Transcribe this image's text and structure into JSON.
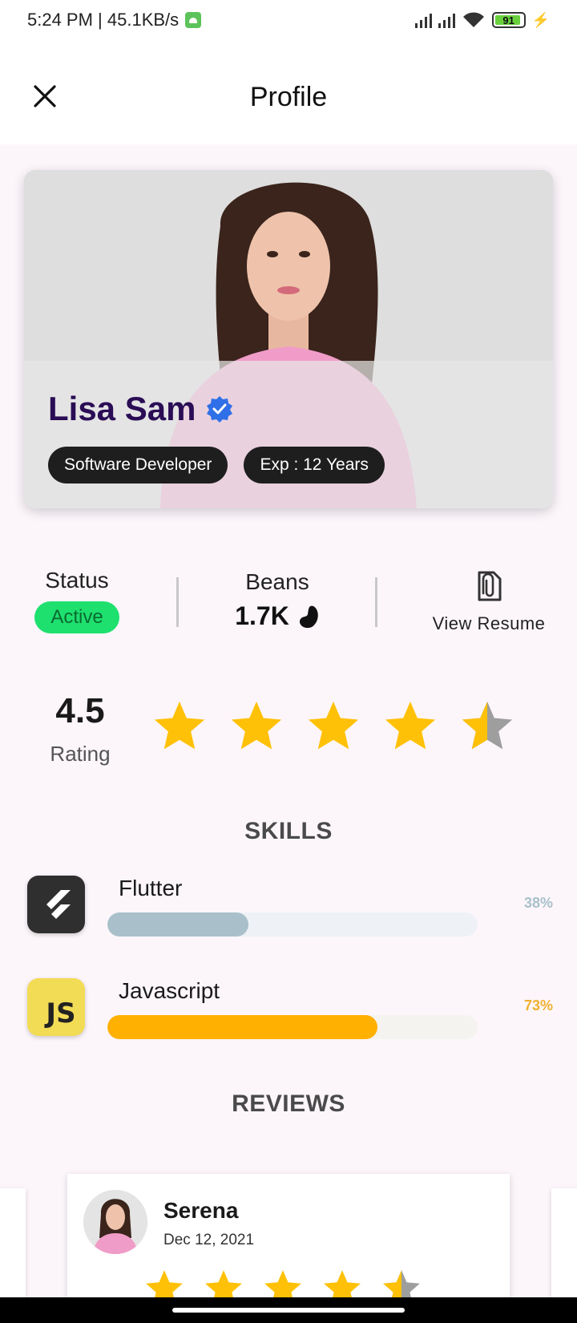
{
  "status_bar": {
    "time_speed": "5:24 PM | 45.1KB/s",
    "battery": "91"
  },
  "header": {
    "title": "Profile"
  },
  "profile": {
    "name": "Lisa Sam",
    "chips": [
      "Software Developer",
      "Exp : 12 Years"
    ]
  },
  "stats": {
    "status_label": "Status",
    "status_value": "Active",
    "beans_label": "Beans",
    "beans_value": "1.7K",
    "resume_label": "View Resume"
  },
  "rating": {
    "value": "4.5",
    "label": "Rating",
    "stars": 4.5
  },
  "skills": {
    "title": "SKILLS",
    "items": [
      {
        "name": "Flutter",
        "percent_label": "38%",
        "level": 0.38,
        "color": "#a9c0ca",
        "track": "#eef2f6",
        "pct_color": "#a9c0ca"
      },
      {
        "name": "Javascript",
        "percent_label": "73%",
        "level": 0.73,
        "color": "#ffb000",
        "track": "#f5f3ef",
        "pct_color": "#f0b030"
      }
    ]
  },
  "reviews": {
    "title": "REVIEWS",
    "items": [
      {
        "name": "Serena",
        "date": "Dec 12, 2021",
        "stars": 4.5
      }
    ]
  },
  "colors": {
    "star": "#ffc107",
    "star_empty": "#9e9e9e",
    "name": "#2a0d55",
    "active": "#1ee06e"
  }
}
